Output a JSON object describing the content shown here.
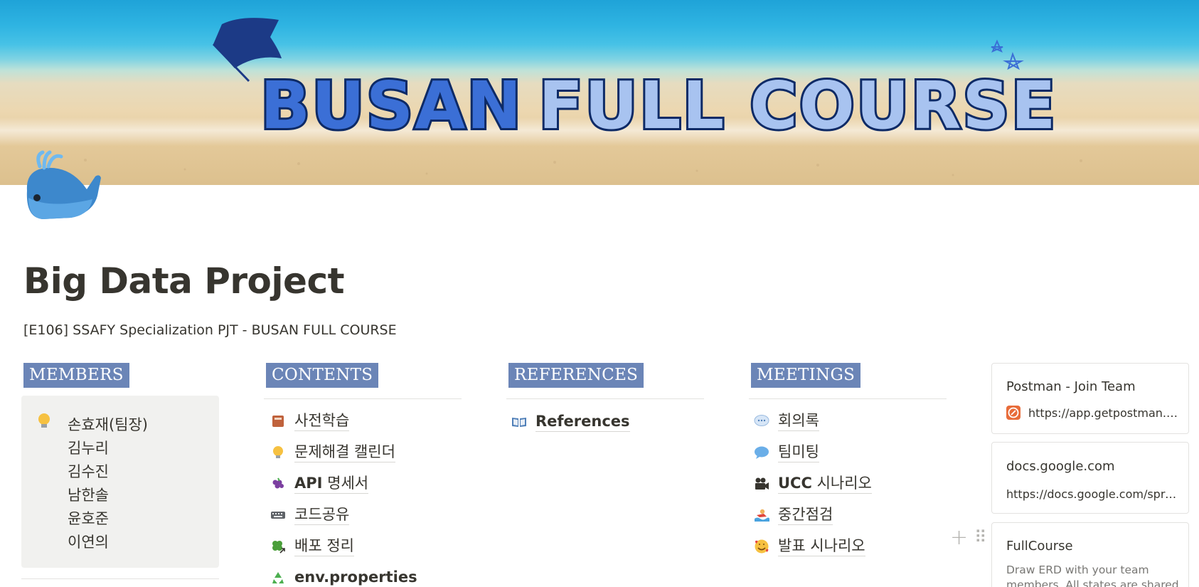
{
  "cover": {
    "banner_text": "BUSAN FULL COURSE",
    "colors": {
      "banner_fill": "#3b6fd6",
      "banner_light": "#a8c3f0",
      "banner_outline": "#0d2a66"
    },
    "icons": [
      "flag-icon",
      "stars-icon"
    ]
  },
  "page": {
    "icon": "whale-icon",
    "title": "Big Data Project",
    "subtitle": "[E106] SSAFY Specialization PJT - BUSAN FULL COURSE"
  },
  "members": {
    "header": "MEMBERS",
    "icon": "lightbulb-icon",
    "names": [
      "손효재(팀장)",
      "김누리",
      "김수진",
      "남한솔",
      "윤호준",
      "이연의"
    ]
  },
  "contents": {
    "header": "CONTENTS",
    "items": [
      {
        "icon": "book-icon",
        "label": "사전학습",
        "bold": false
      },
      {
        "icon": "lightbulb-icon",
        "label": "문제해결 캘린더",
        "bold": false
      },
      {
        "icon": "grapes-icon",
        "label_bold": "API",
        "label": " 명세서",
        "bold": true
      },
      {
        "icon": "keyboard-icon",
        "label": "코드공유",
        "bold": false
      },
      {
        "icon": "clover-icon",
        "label": "배포 정리",
        "bold": false
      },
      {
        "icon": "recycle-icon",
        "label": "env.properties",
        "bold": true
      }
    ]
  },
  "references": {
    "header": "REFERENCES",
    "items": [
      {
        "icon": "open-book-icon",
        "label": "References",
        "bold": true
      }
    ]
  },
  "meetings": {
    "header": "MEETINGS",
    "items": [
      {
        "icon": "speech-bubble-icon",
        "label": "회의록",
        "bold": false
      },
      {
        "icon": "chat-bubble-icon",
        "label": "팀미팅",
        "bold": false
      },
      {
        "icon": "movie-camera-icon",
        "label_bold": "UCC",
        "label": " 시나리오",
        "bold": true
      },
      {
        "icon": "swimmer-icon",
        "label": "중간점검",
        "bold": false
      },
      {
        "icon": "smiling-hearts-icon",
        "label": "발표 시나리오",
        "bold": false
      }
    ]
  },
  "bookmarks": [
    {
      "title": "Postman - Join Team",
      "url": "https://app.getpostman.co...",
      "icon": "postman-icon"
    },
    {
      "title": "docs.google.com",
      "url": "https://docs.google.com/sprea..."
    },
    {
      "title": "FullCourse",
      "description": "Draw ERD with your team members. All states are shared"
    }
  ],
  "controls": {
    "add": "+",
    "drag": "⠿"
  }
}
